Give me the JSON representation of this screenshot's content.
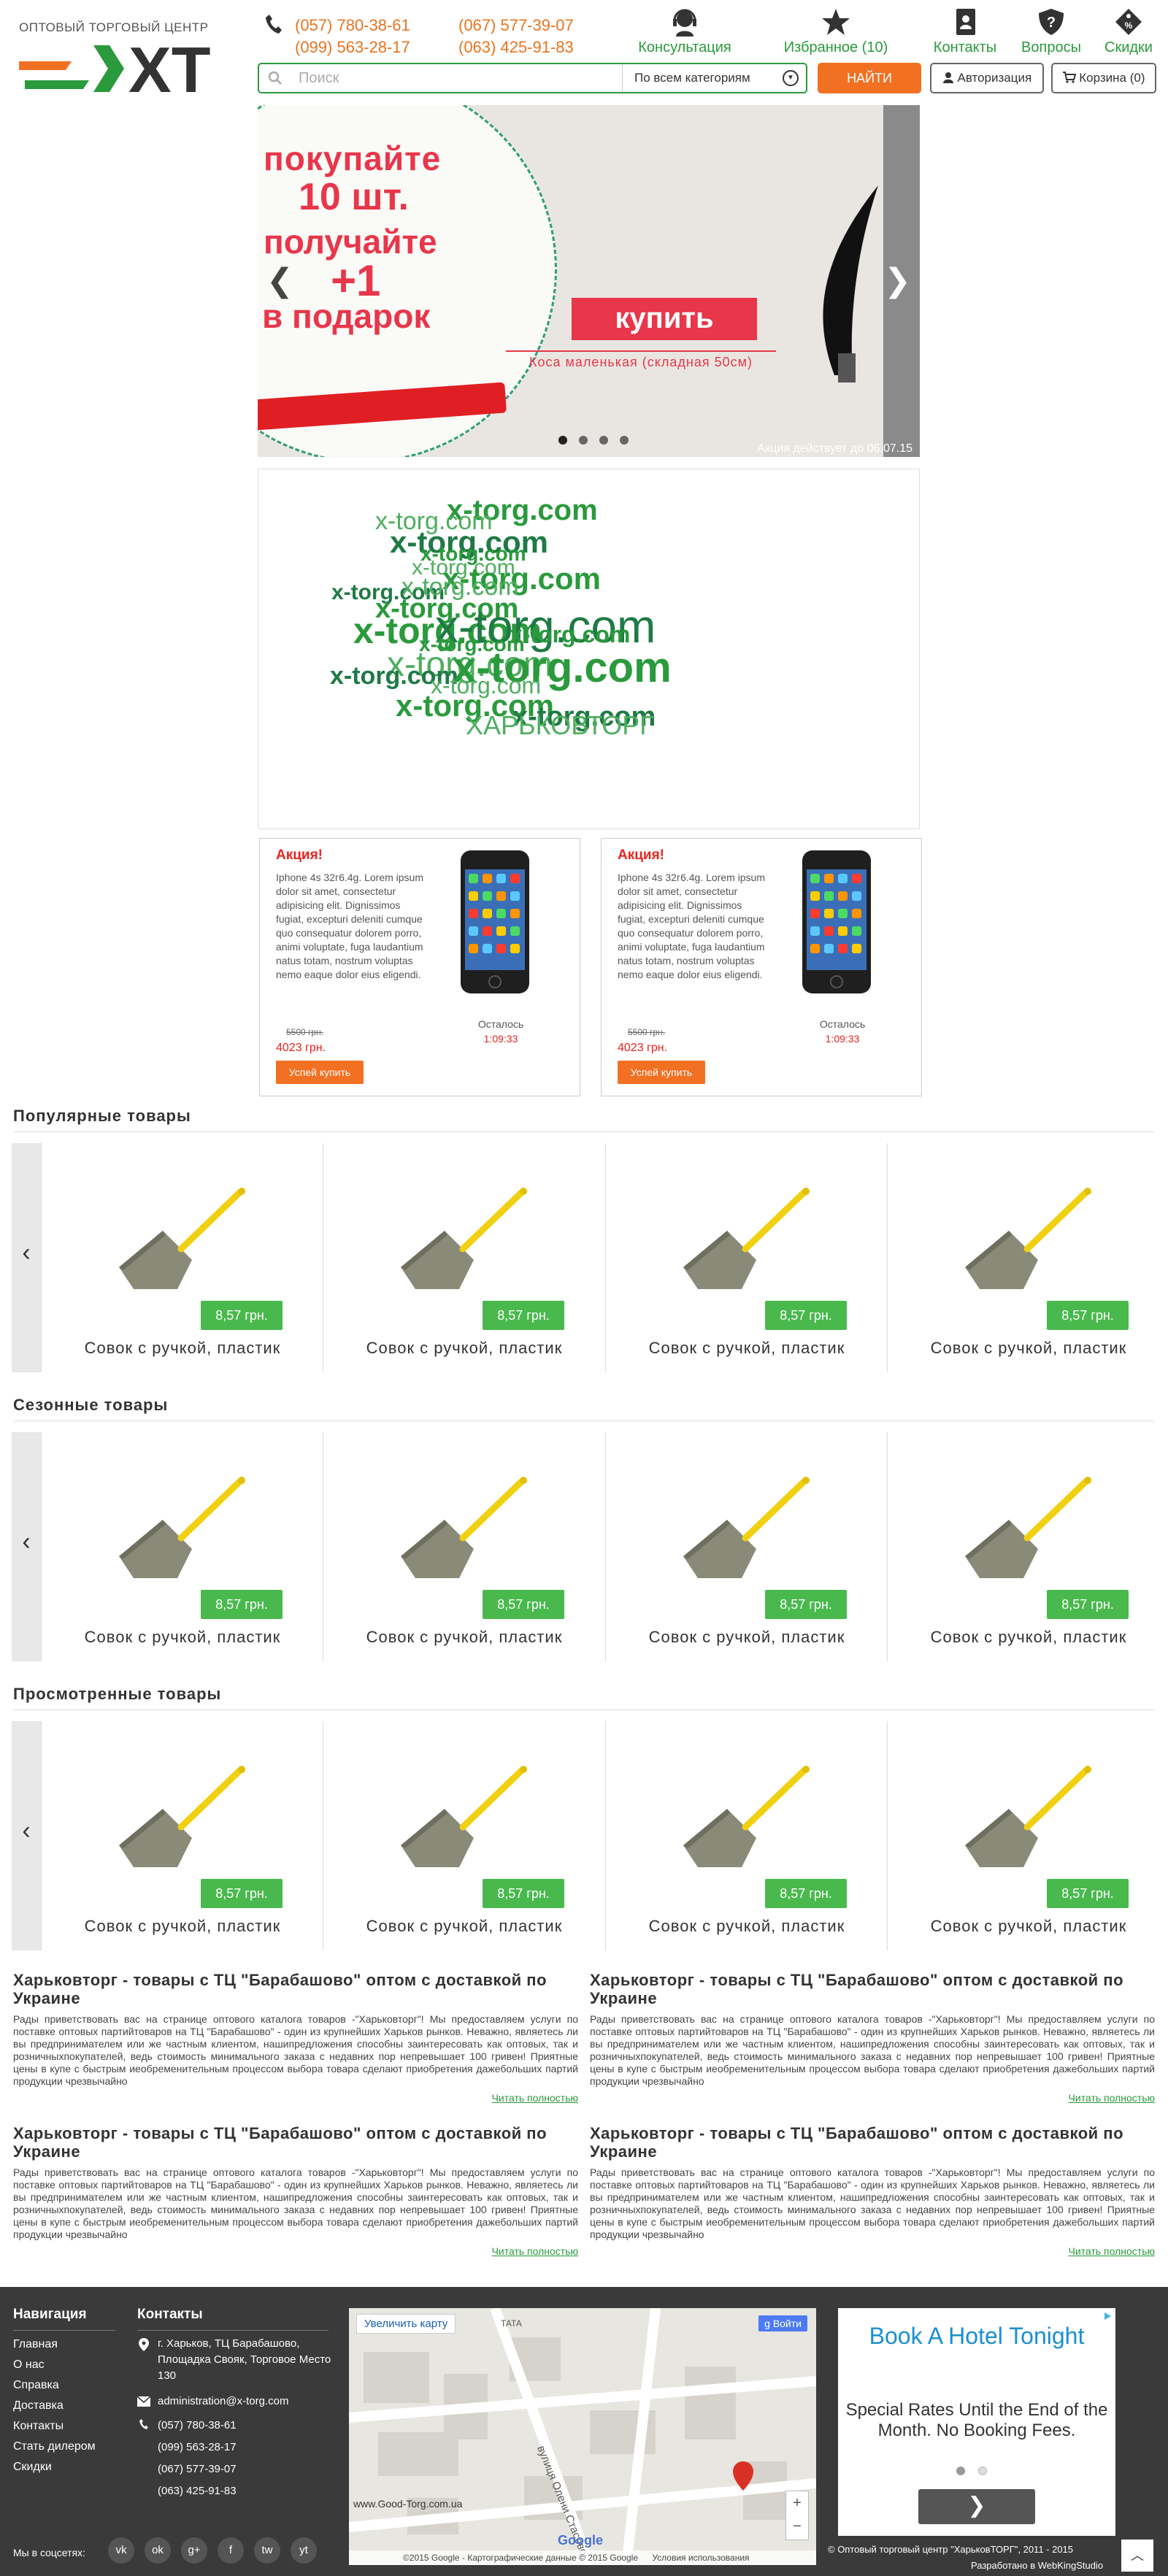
{
  "header": {
    "logo_caption": "ОПТОВЫЙ ТОРГОВЫЙ ЦЕНТР",
    "logo_letters": "XT",
    "phones": [
      "(057) 780-38-61",
      "(067) 577-39-07",
      "(099) 563-28-17",
      "(063) 425-91-83"
    ],
    "icons": [
      {
        "label": "Консультация",
        "icon": "support-icon"
      },
      {
        "label": "Избранное (10)",
        "icon": "star-icon"
      },
      {
        "label": "Контакты",
        "icon": "contacts-icon"
      },
      {
        "label": "Вопросы",
        "icon": "question-icon"
      },
      {
        "label": "Скидки",
        "icon": "discount-tag-icon"
      }
    ],
    "search_placeholder": "Поиск",
    "category_select": "По всем категориям",
    "find_label": "НАЙТИ",
    "login_label": "Авторизация",
    "cart_label": "Корзина (0)"
  },
  "slider": {
    "line1": "покупайте",
    "line2": "10 шт.",
    "line3": "получайте",
    "line4": "+1",
    "line5": "в подарок",
    "buy": "купить",
    "subtitle": "Коса маленькая (складная 50см)",
    "note": "Акция действует до 06.07.15",
    "slides": 4,
    "active_slide": 1
  },
  "cloud_words": [
    "x-torg.com",
    "x-torg.com",
    "x-torg.com",
    "x-torg.com",
    "x-torg.com",
    "x-torg.com",
    "x-torg.com",
    "x-torg.com",
    "x-torg.com",
    "x-torg.com",
    "x-torg.com",
    "x-torg.com",
    "x-torg.com",
    "x-torg.com",
    "x-torg.com",
    "x-torg.com",
    "x-torg.com",
    "x-torg.com",
    "x-torg.com",
    "ХАРЬКОВТОРГ"
  ],
  "promos": [
    {
      "heading": "Акция!",
      "text": "Iphone 4s 32г6.4g. Lorem ipsum dolor sit amet, consectetur adipisicing elit. Dignissimos fugiat, excepturi deleniti cumque quo consequatur dolorem porro, animi voluptate, fuga laudantium natus totam, nostrum voluptas nemo eaque dolor eius eligendi.",
      "old_price": "5500 грн.",
      "new_price": "4023 грн.",
      "left_label": "Осталось",
      "timer": "1:09:33",
      "button": "Успей купить"
    },
    {
      "heading": "Акция!",
      "text": "Iphone 4s 32г6.4g. Lorem ipsum dolor sit amet, consectetur adipisicing elit. Dignissimos fugiat, excepturi deleniti cumque quo consequatur dolorem porro, animi voluptate, fuga laudantium natus totam, nostrum voluptas nemo eaque dolor eius eligendi.",
      "old_price": "5500 грн.",
      "new_price": "4023 грн.",
      "left_label": "Осталось",
      "timer": "1:09:33",
      "button": "Успей купить"
    }
  ],
  "sections": [
    {
      "title": "Популярные товары",
      "products": [
        {
          "name": "Совок с ручкой, пластик",
          "price": "8,57 грн."
        },
        {
          "name": "Совок с ручкой, пластик",
          "price": "8,57 грн."
        },
        {
          "name": "Совок с ручкой, пластик",
          "price": "8,57 грн."
        },
        {
          "name": "Совок с ручкой, пластик",
          "price": "8,57 грн."
        }
      ]
    },
    {
      "title": "Сезонные товары",
      "products": [
        {
          "name": "Совок с ручкой, пластик",
          "price": "8,57 грн."
        },
        {
          "name": "Совок с ручкой, пластик",
          "price": "8,57 грн."
        },
        {
          "name": "Совок с ручкой, пластик",
          "price": "8,57 грн."
        },
        {
          "name": "Совок с ручкой, пластик",
          "price": "8,57 грн."
        }
      ]
    },
    {
      "title": "Просмотренные товары",
      "products": [
        {
          "name": "Совок с ручкой, пластик",
          "price": "8,57 грн."
        },
        {
          "name": "Совок с ручкой, пластик",
          "price": "8,57 грн."
        },
        {
          "name": "Совок с ручкой, пластик",
          "price": "8,57 грн."
        },
        {
          "name": "Совок с ручкой, пластик",
          "price": "8,57 грн."
        }
      ]
    }
  ],
  "articles": [
    {
      "title": "Харьковторг - товары с ТЦ \"Барабашово\" оптом с доставкой по Украине",
      "body": "Рады приветствовать вас на странице оптового каталога товаров -\"Харьковторг\"! Мы предоставляем услуги по поставке оптовых партийтоваров на ТЦ \"Барабашово\" - один из крупнейших Харьков рынков. Неважно, являетесь ли вы предпринимателем или же частным клиентом, нашипредложения способны заинтересовать как оптовых, так и розничныхпокупателей, ведь стоимость минимального заказа с недавних пор непревышает 100 гривен! Приятные цены в купе с быстрым иеобременительным процессом выбора товара сделают приобретения дажебольших партий продукции чрезвычайно",
      "more": "Читать полностью"
    },
    {
      "title": "Харьковторг - товары с ТЦ \"Барабашово\" оптом с доставкой по Украине",
      "body": "Рады приветствовать вас на странице оптового каталога товаров -\"Харьковторг\"! Мы предоставляем услуги по поставке оптовых партийтоваров на ТЦ \"Барабашово\" - один из крупнейших Харьков рынков. Неважно, являетесь ли вы предпринимателем или же частным клиентом, нашипредложения способны заинтересовать как оптовых, так и розничныхпокупателей, ведь стоимость минимального заказа с недавних пор непревышает 100 гривен! Приятные цены в купе с быстрым иеобременительным процессом выбора товара сделают приобретения дажебольших партий продукции чрезвычайно",
      "more": "Читать полностью"
    },
    {
      "title": "Харьковторг - товары с ТЦ \"Барабашово\" оптом с доставкой по Украине",
      "body": "Рады приветствовать вас на странице оптового каталога товаров -\"Харьковторг\"! Мы предоставляем услуги по поставке оптовых партийтоваров на ТЦ \"Барабашово\" - один из крупнейших Харьков рынков. Неважно, являетесь ли вы предпринимателем или же частным клиентом, нашипредложения способны заинтересовать как оптовых, так и розничныхпокупателей, ведь стоимость минимального заказа с недавних пор непревышает 100 гривен! Приятные цены в купе с быстрым иеобременительным процессом выбора товара сделают приобретения дажебольших партий продукции чрезвычайно",
      "more": "Читать полностью"
    },
    {
      "title": "Харьковторг - товары с ТЦ \"Барабашово\" оптом с доставкой по Украине",
      "body": "Рады приветствовать вас на странице оптового каталога товаров -\"Харьковторг\"! Мы предоставляем услуги по поставке оптовых партийтоваров на ТЦ \"Барабашово\" - один из крупнейших Харьков рынков. Неважно, являетесь ли вы предпринимателем или же частным клиентом, нашипредложения способны заинтересовать как оптовых, так и розничныхпокупателей, ведь стоимость минимального заказа с недавних пор непревышает 100 гривен! Приятные цены в купе с быстрым иеобременительным процессом выбора товара сделают приобретения дажебольших партий продукции чрезвычайно",
      "more": "Читать полностью"
    }
  ],
  "footer": {
    "nav_title": "Навигация",
    "nav": [
      "Главная",
      "О нас",
      "Справка",
      "Доставка",
      "Контакты",
      "Стать дилером",
      "Скидки"
    ],
    "contacts_title": "Контакты",
    "address": "г. Харьков, ТЦ Барабашово, Площадка Свояк, Торговое Место 130",
    "email": "administration@x-torg.com",
    "phones": [
      "(057) 780-38-61",
      "(099) 563-28-17",
      "(067) 577-39-07",
      "(063) 425-91-83"
    ],
    "social_label": "Мы в соцсетях:",
    "social": [
      "vk",
      "ok",
      "g+",
      "f",
      "tw",
      "yt"
    ],
    "map": {
      "enlarge": "Увеличить карту",
      "login": "Войти",
      "place": "ТАТА",
      "street": "вулиця Олени Стасової",
      "site": "www.Good-Torg.com.ua",
      "brand": "Google",
      "copyright": "©2015 Google - Картографические данные © 2015 Google",
      "terms": "Условия использования"
    },
    "ad": {
      "title": "Book A Hotel Tonight",
      "text": "Special Rates Until the End of the Month. No Booking Fees."
    },
    "copyright": "© Оптовый торговый центр \"ХарьковТОРГ\", 2011 - 2015",
    "developer": "Разработано в WebKingStudio"
  },
  "colors": {
    "accent_green": "#2a9a3c",
    "accent_orange": "#f27022",
    "sale_red": "#e8231e",
    "price_green": "#49b94d",
    "footer_bg": "#3a3a3a"
  }
}
